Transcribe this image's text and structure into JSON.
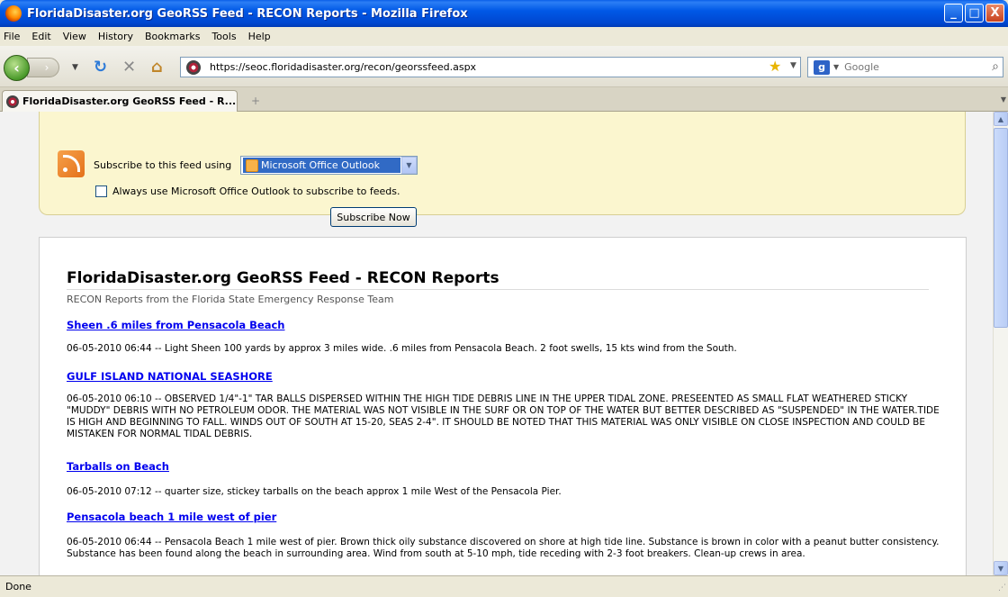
{
  "window": {
    "title": "FloridaDisaster.org GeoRSS Feed - RECON Reports - Mozilla Firefox",
    "minimize": "_",
    "maximize": "□",
    "close": "X"
  },
  "menu": [
    "File",
    "Edit",
    "View",
    "History",
    "Bookmarks",
    "Tools",
    "Help"
  ],
  "nav": {
    "url": "https://seoc.floridadisaster.org/recon/georssfeed.aspx",
    "search_placeholder": "Google",
    "back_icon": "back-arrow-icon",
    "reload_icon": "reload-icon",
    "stop_icon": "stop-icon",
    "home_icon": "home-icon"
  },
  "tab": {
    "label": "FloridaDisaster.org GeoRSS Feed - R...",
    "new_tab": "+"
  },
  "subscribe": {
    "label": "Subscribe to this feed using",
    "selected_reader": "Microsoft Office Outlook",
    "always_label": "Always use Microsoft Office Outlook to subscribe to feeds.",
    "always_checked": false,
    "button": "Subscribe Now"
  },
  "feed": {
    "title": "FloridaDisaster.org GeoRSS Feed - RECON Reports",
    "subtitle": "RECON Reports from the Florida State Emergency Response Team",
    "entries": [
      {
        "title": "Sheen .6 miles from Pensacola Beach",
        "body": "06-05-2010 06:44 -- Light Sheen 100 yards by approx 3 miles wide. .6 miles from Pensacola Beach. 2 foot swells, 15 kts wind from the South."
      },
      {
        "title": "GULF ISLAND NATIONAL SEASHORE",
        "body": "06-05-2010 06:10 -- OBSERVED 1/4\"-1\" TAR BALLS DISPERSED WITHIN THE HIGH TIDE DEBRIS LINE IN THE UPPER TIDAL ZONE. PRESEENTED AS SMALL FLAT WEATHERED STICKY \"MUDDY\" DEBRIS WITH NO PETROLEUM ODOR. THE MATERIAL WAS NOT VISIBLE IN THE SURF OR ON TOP OF THE WATER BUT BETTER DESCRIBED AS \"SUSPENDED\" IN THE WATER.TIDE IS HIGH AND BEGINNING TO FALL. WINDS OUT OF SOUTH AT 15-20, SEAS 2-4\". IT SHOULD BE NOTED THAT THIS MATERIAL WAS ONLY VISIBLE ON CLOSE INSPECTION AND COULD BE MISTAKEN FOR NORMAL TIDAL DEBRIS."
      },
      {
        "title": "Tarballs on Beach",
        "body": "06-05-2010 07:12 -- quarter size, stickey tarballs on the beach approx 1 mile West of the Pensacola Pier."
      },
      {
        "title": "Pensacola beach 1 mile west of pier",
        "body": "06-05-2010 06:44 -- Pensacola Beach 1 mile west of pier. Brown thick oily substance discovered on shore at high tide line. Substance is brown in color with a peanut butter consistency. Substance has been found along the beach in surrounding area. Wind from south at 5-10 mph, tide receding with 2-3 foot breakers. Clean-up crews in area."
      }
    ]
  },
  "status": "Done"
}
